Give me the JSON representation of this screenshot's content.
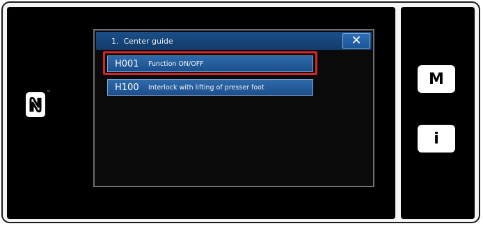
{
  "window": {
    "title": "1.  Center guide",
    "close_icon": "close-icon"
  },
  "menu": {
    "items": [
      {
        "code": "H001",
        "label": "Function ON/OFF",
        "selected": true
      },
      {
        "code": "H100",
        "label": "Interlock with lifting of presser foot",
        "selected": false
      }
    ]
  },
  "side_buttons": {
    "mode_label": "M",
    "info_label": "i"
  },
  "nfc": {
    "icon": "nfc-icon",
    "trademark": "™"
  },
  "colors": {
    "titlebar": "#1b4f88",
    "item": "#2e6aab",
    "highlight": "#d6242b"
  }
}
